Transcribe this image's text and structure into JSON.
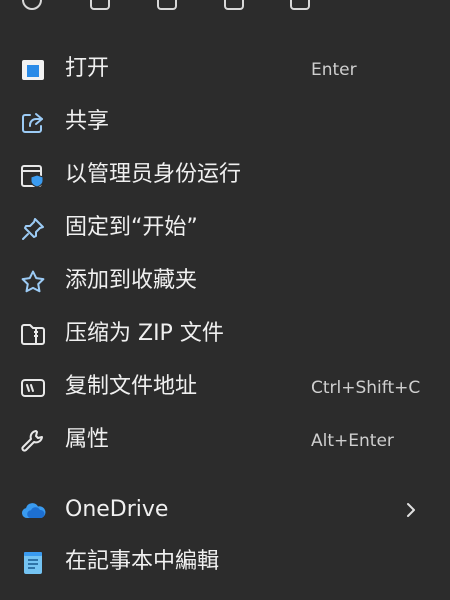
{
  "colors": {
    "background": "#2c2c2c",
    "text": "#f0f0f0",
    "shortcut": "#cfcfcf",
    "accent_blue": "#3a9bf0"
  },
  "top_icons": [
    "cut-icon",
    "copy-icon",
    "paste-icon",
    "rename-icon",
    "delete-icon"
  ],
  "menu": {
    "open": {
      "label": "打开",
      "shortcut": "Enter",
      "icon": "open-window-icon"
    },
    "share": {
      "label": "共享",
      "icon": "share-icon"
    },
    "run_as_admin": {
      "label": "以管理员身份运行",
      "icon": "shield-window-icon"
    },
    "pin_start": {
      "label": "固定到“开始”",
      "icon": "pin-icon"
    },
    "add_favorites": {
      "label": "添加到收藏夹",
      "icon": "star-icon"
    },
    "compress_zip": {
      "label": "压缩为 ZIP 文件",
      "icon": "zip-folder-icon"
    },
    "copy_path": {
      "label": "复制文件地址",
      "shortcut": "Ctrl+Shift+C",
      "icon": "path-icon"
    },
    "properties": {
      "label": "属性",
      "shortcut": "Alt+Enter",
      "icon": "wrench-icon"
    },
    "onedrive": {
      "label": "OneDrive",
      "icon": "onedrive-cloud-icon",
      "submenu": true
    },
    "notepad": {
      "label": "在記事本中編輯",
      "icon": "notepad-icon"
    }
  }
}
